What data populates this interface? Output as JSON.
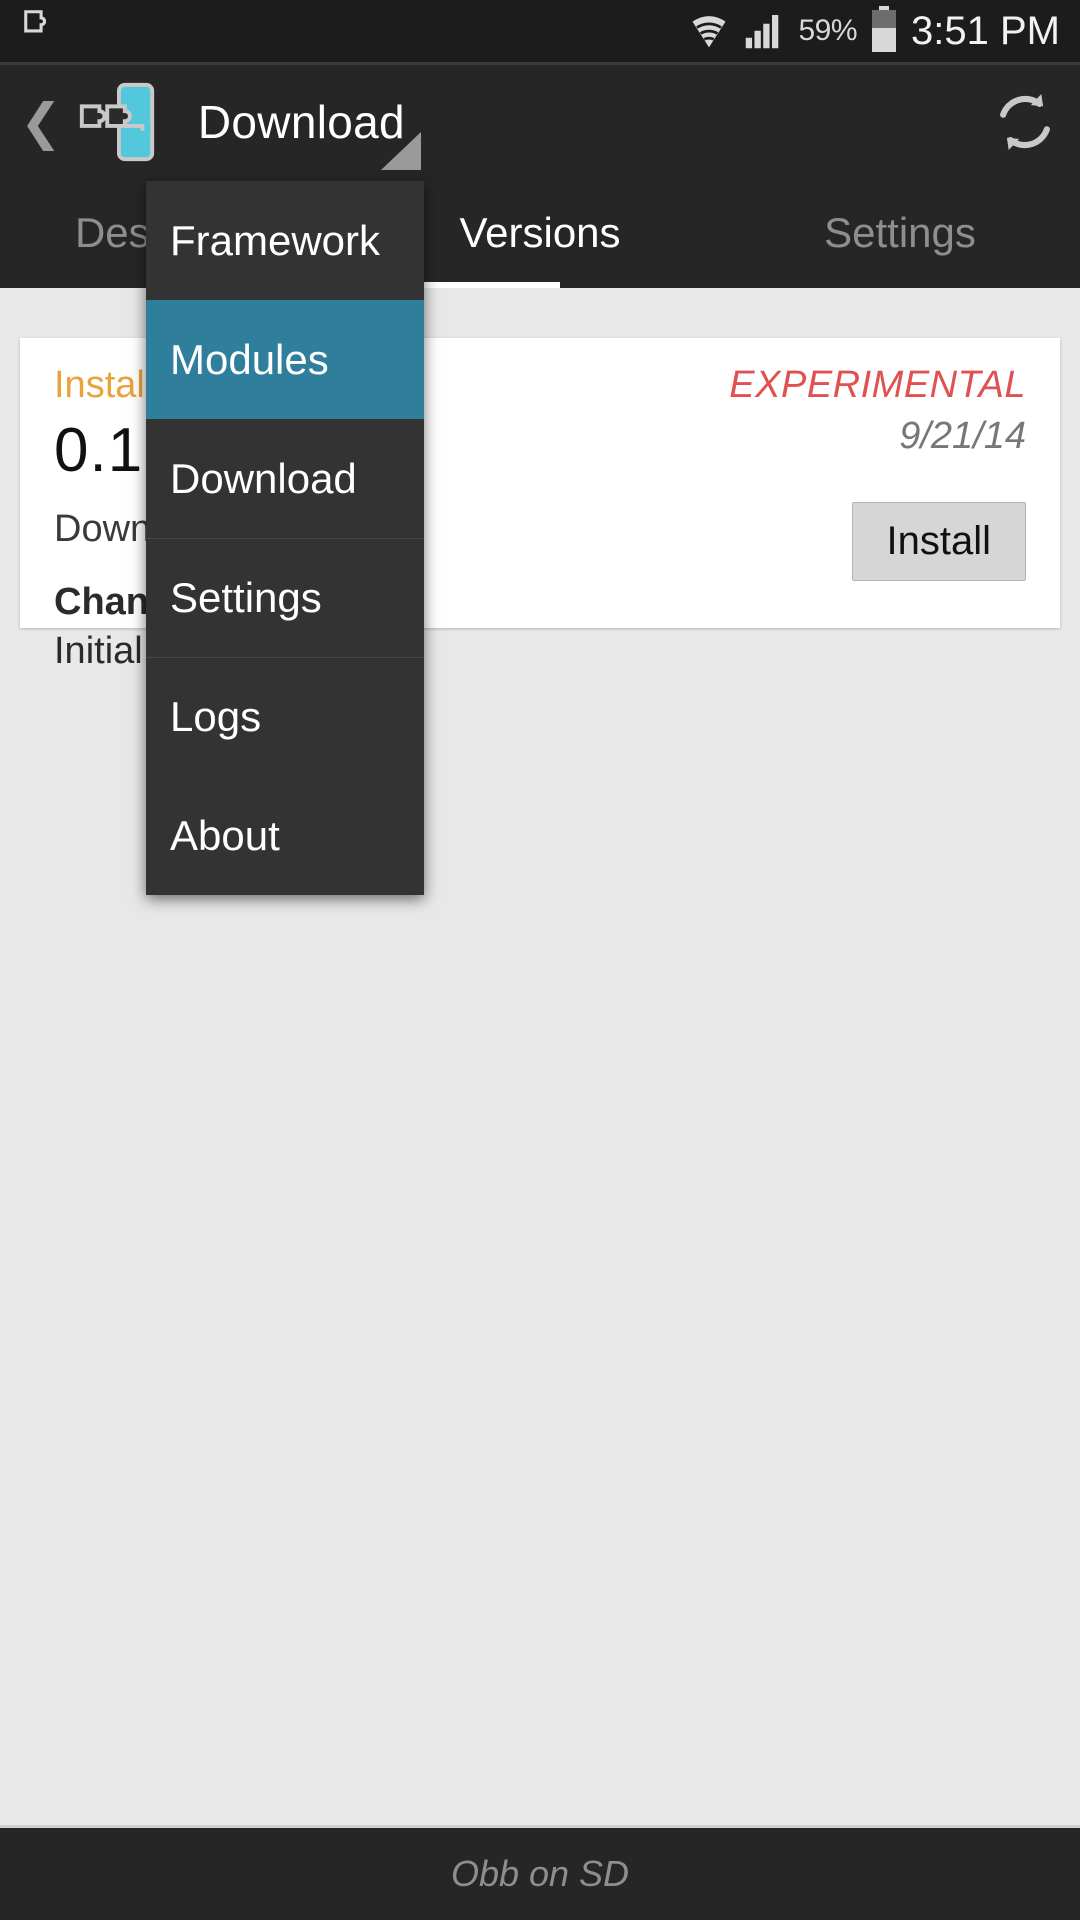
{
  "statusbar": {
    "notification_icon": "xposed-puzzle-icon",
    "wifi_icon": "wifi-icon",
    "signal_icon": "cellular-signal-icon",
    "battery_percent": "59%",
    "battery_icon": "battery-icon",
    "clock": "3:51 PM"
  },
  "actionbar": {
    "back_icon": "back-chevron-icon",
    "app_icon": "xposed-installer-icon",
    "title": "Download",
    "spinner_icon": "dropdown-triangle-icon",
    "refresh_icon": "refresh-icon",
    "accent_color": "#53c8dd"
  },
  "tabs": {
    "items": [
      {
        "label": "Description",
        "active": false
      },
      {
        "label": "Versions",
        "active": true
      },
      {
        "label": "Settings",
        "active": false
      }
    ],
    "indicator_color": "#ffffff"
  },
  "menu": {
    "items": [
      {
        "label": "Framework",
        "selected": false,
        "divided": false
      },
      {
        "label": "Modules",
        "selected": true,
        "divided": false
      },
      {
        "label": "Download",
        "selected": false,
        "divided": false
      },
      {
        "label": "Settings",
        "selected": false,
        "divided": true
      },
      {
        "label": "Logs",
        "selected": false,
        "divided": true
      },
      {
        "label": "About",
        "selected": false,
        "divided": false
      }
    ],
    "selected_color": "#2f7e9b",
    "background_color": "#333333"
  },
  "card": {
    "status_label": "Installed",
    "version": "0.1",
    "download_label": "Download",
    "changes_title": "Changes",
    "changes_text": "Initial version",
    "badge": "EXPERIMENTAL",
    "date": "9/21/14",
    "install_button": "Install",
    "badge_color": "#e05151",
    "status_color": "#e8a33d"
  },
  "bottombar": {
    "text": "Obb on SD"
  }
}
